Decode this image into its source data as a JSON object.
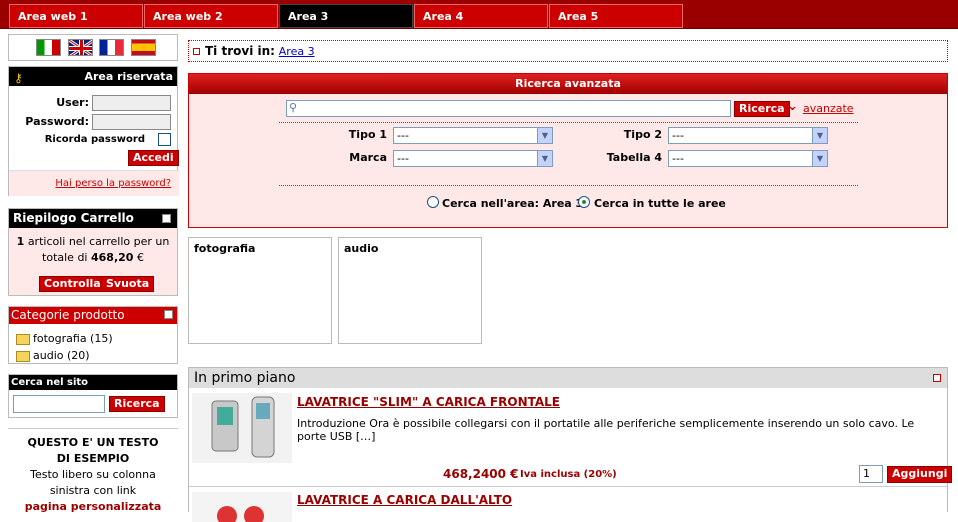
{
  "nav": {
    "tabs": [
      {
        "label": "Area web 1"
      },
      {
        "label": "Area web 2"
      },
      {
        "label": "Area 3"
      },
      {
        "label": "Area 4"
      },
      {
        "label": "Area 5"
      }
    ]
  },
  "colors": {
    "brand_red": "#c00000",
    "dark_red": "#9b0000",
    "panel_pink": "#ffe8e8"
  },
  "login": {
    "title": "Area riservata",
    "user_label": "User:",
    "password_label": "Password:",
    "remember_label": "Ricorda password",
    "submit_label": "Accedi",
    "forgot_link": "Hai perso la password?"
  },
  "cart": {
    "title": "Riepilogo Carrello",
    "count": "1",
    "text_pre": "articoli nel carrello per un totale di",
    "total": "468,20",
    "currency": "€",
    "check_label": "Controlla",
    "empty_label": "Svuota"
  },
  "categories": {
    "title": "Categorie prodotto",
    "items": [
      {
        "label": "fotografia (15)"
      },
      {
        "label": "audio (20)"
      }
    ]
  },
  "site_search": {
    "title": "Cerca nel sito",
    "value": "",
    "button": "Ricerca"
  },
  "sidebar_text": {
    "heading": "QUESTO E' UN TESTO DI ESEMPIO",
    "body": "Testo libero su colonna sinistra con link",
    "link": "pagina personalizzata"
  },
  "breadcrumb": {
    "prefix": "Ti trovi in:",
    "link": "Area 3"
  },
  "advanced_search": {
    "title": "Ricerca avanzata",
    "query": "",
    "button": "Ricerca",
    "advanced_link": "avanzate",
    "filters": {
      "tipo1": {
        "label": "Tipo 1",
        "value": "---"
      },
      "tipo2": {
        "label": "Tipo 2",
        "value": "---"
      },
      "marca": {
        "label": "Marca",
        "value": "---"
      },
      "tabella4": {
        "label": "Tabella 4",
        "value": "---"
      }
    },
    "radio_area": "Cerca nell'area: Area 3",
    "radio_all": "Cerca in tutte le aree",
    "selected_scope": "all"
  },
  "category_boxes": [
    {
      "label": "fotografia"
    },
    {
      "label": "audio"
    }
  ],
  "featured": {
    "title": "In primo piano",
    "products": [
      {
        "title": "LAVATRICE \"SLIM\" A CARICA FRONTALE",
        "description": "Introduzione Ora è possibile collegarsi con il portatile alle periferiche semplicemente inserendo un solo cavo. Le porte USB […]",
        "price": "468,2400 €",
        "vat_note": "Iva inclusa (20%)",
        "qty": "1",
        "add_label": "Aggiungi"
      },
      {
        "title": "LAVATRICE A CARICA DALL'ALTO"
      }
    ]
  }
}
